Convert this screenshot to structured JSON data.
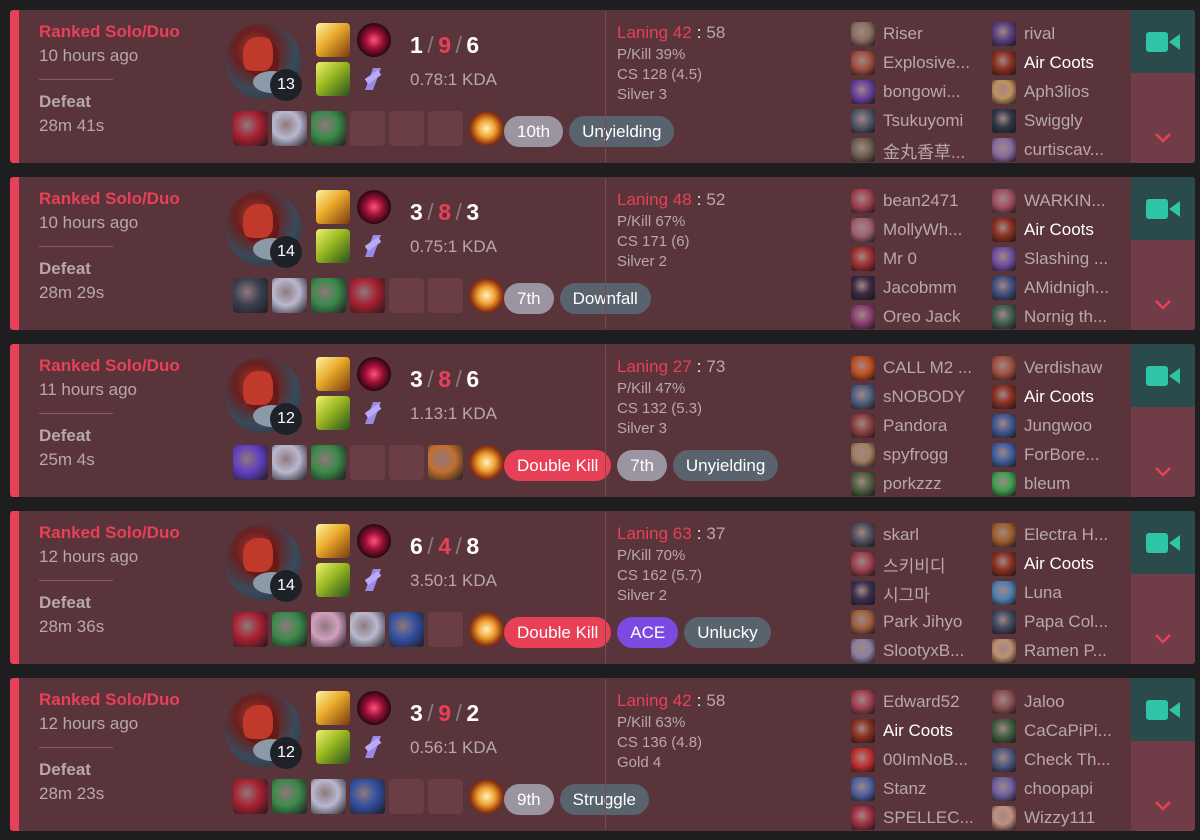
{
  "matches": [
    {
      "queue": "Ranked Solo/Duo",
      "time_ago": "10 hours ago",
      "result": "Defeat",
      "duration": "28m 41s",
      "level": "13",
      "kills": "1",
      "deaths": "9",
      "assists": "6",
      "kda_ratio": "0.78:1 KDA",
      "items": [
        "#a82030",
        "#b8b8d0",
        "#3a8a4a",
        "",
        "",
        ""
      ],
      "badges": [
        {
          "label": "10th",
          "style": "gray"
        },
        {
          "label": "Unyielding",
          "style": "slate"
        }
      ],
      "laning_label": "Laning 42",
      "laning_opp": "58",
      "pkill": "P/Kill 39%",
      "cs": "CS 128 (4.5)",
      "tier": "Silver 3",
      "team_left": [
        {
          "name": "Riser",
          "color": "#8a7060"
        },
        {
          "name": "Explosive...",
          "color": "#a05040"
        },
        {
          "name": "bongowi...",
          "color": "#6a40a0"
        },
        {
          "name": "Tsukuyomi",
          "color": "#505868"
        },
        {
          "name": "金丸香草...",
          "color": "#706050"
        }
      ],
      "team_right": [
        {
          "name": "rival",
          "color": "#5a4080"
        },
        {
          "name": "Air Coots",
          "color": "#8a3020",
          "me": true
        },
        {
          "name": "Aph3lios",
          "color": "#c09060"
        },
        {
          "name": "Swiggly",
          "color": "#303848"
        },
        {
          "name": "curtiscav...",
          "color": "#8a6aa0"
        }
      ]
    },
    {
      "queue": "Ranked Solo/Duo",
      "time_ago": "10 hours ago",
      "result": "Defeat",
      "duration": "28m 29s",
      "level": "14",
      "kills": "3",
      "deaths": "8",
      "assists": "3",
      "kda_ratio": "0.75:1 KDA",
      "items": [
        "#3a4050",
        "#b8b8d0",
        "#3a8a4a",
        "#a82030",
        "",
        ""
      ],
      "badges": [
        {
          "label": "7th",
          "style": "gray"
        },
        {
          "label": "Downfall",
          "style": "slate"
        }
      ],
      "laning_label": "Laning 48",
      "laning_opp": "52",
      "pkill": "P/Kill 67%",
      "cs": "CS 171 (6)",
      "tier": "Silver 2",
      "team_left": [
        {
          "name": "bean2471",
          "color": "#a04050"
        },
        {
          "name": "MollyWh...",
          "color": "#a06070"
        },
        {
          "name": "Mr 0",
          "color": "#a03030"
        },
        {
          "name": "Jacobmm",
          "color": "#3a2a40"
        },
        {
          "name": "Oreo Jack",
          "color": "#8a4070"
        }
      ],
      "team_right": [
        {
          "name": "WARKIN...",
          "color": "#a05060"
        },
        {
          "name": "Air Coots",
          "color": "#8a3020",
          "me": true
        },
        {
          "name": "Slashing ...",
          "color": "#7050a0"
        },
        {
          "name": "AMidnigh...",
          "color": "#405080"
        },
        {
          "name": "Nornig th...",
          "color": "#406050"
        }
      ]
    },
    {
      "queue": "Ranked Solo/Duo",
      "time_ago": "11 hours ago",
      "result": "Defeat",
      "duration": "25m 4s",
      "level": "12",
      "kills": "3",
      "deaths": "8",
      "assists": "6",
      "kda_ratio": "1.13:1 KDA",
      "items": [
        "#6040c0",
        "#b8b8d0",
        "#3a8a4a",
        "",
        "",
        "#c07030"
      ],
      "badges": [
        {
          "label": "Double Kill",
          "style": "red"
        },
        {
          "label": "7th",
          "style": "gray"
        },
        {
          "label": "Unyielding",
          "style": "slate"
        }
      ],
      "laning_label": "Laning 27",
      "laning_opp": "73",
      "pkill": "P/Kill 47%",
      "cs": "CS 132 (5.3)",
      "tier": "Silver 3",
      "team_left": [
        {
          "name": "CALL M2 ...",
          "color": "#c05020"
        },
        {
          "name": "sNOBODY",
          "color": "#506080"
        },
        {
          "name": "Pandora",
          "color": "#8a4040"
        },
        {
          "name": "spyfrogg",
          "color": "#a08060"
        },
        {
          "name": "porkzzz",
          "color": "#506040"
        }
      ],
      "team_right": [
        {
          "name": "Verdishaw",
          "color": "#a05040"
        },
        {
          "name": "Air Coots",
          "color": "#8a3020",
          "me": true
        },
        {
          "name": "Jungwoo",
          "color": "#405890"
        },
        {
          "name": "ForBore...",
          "color": "#4060a0"
        },
        {
          "name": "bleum",
          "color": "#40a050"
        }
      ]
    },
    {
      "queue": "Ranked Solo/Duo",
      "time_ago": "12 hours ago",
      "result": "Defeat",
      "duration": "28m 36s",
      "level": "14",
      "kills": "6",
      "deaths": "4",
      "assists": "8",
      "kda_ratio": "3.50:1 KDA",
      "items": [
        "#a82030",
        "#3a8a4a",
        "#d0a0c0",
        "#b8b8d0",
        "#3050a0",
        ""
      ],
      "badges": [
        {
          "label": "Double Kill",
          "style": "red"
        },
        {
          "label": "ACE",
          "style": "purple"
        },
        {
          "label": "Unlucky",
          "style": "slate"
        }
      ],
      "laning_label": "Laning 63",
      "laning_opp": "37",
      "pkill": "P/Kill 70%",
      "cs": "CS 162 (5.7)",
      "tier": "Silver 2",
      "team_left": [
        {
          "name": "skarl",
          "color": "#505060"
        },
        {
          "name": "스키비디",
          "color": "#a04050"
        },
        {
          "name": "시그마",
          "color": "#3a3050"
        },
        {
          "name": "Park Jihyo",
          "color": "#a06040"
        },
        {
          "name": "SlootyxB...",
          "color": "#8a80a0"
        }
      ],
      "team_right": [
        {
          "name": "Electra H...",
          "color": "#a06030"
        },
        {
          "name": "Air Coots",
          "color": "#8a3020",
          "me": true
        },
        {
          "name": "Luna",
          "color": "#5080b0"
        },
        {
          "name": "Papa Col...",
          "color": "#404860"
        },
        {
          "name": "Ramen P...",
          "color": "#c09070"
        }
      ]
    },
    {
      "queue": "Ranked Solo/Duo",
      "time_ago": "12 hours ago",
      "result": "Defeat",
      "duration": "28m 23s",
      "level": "12",
      "kills": "3",
      "deaths": "9",
      "assists": "2",
      "kda_ratio": "0.56:1 KDA",
      "items": [
        "#a82030",
        "#3a8a4a",
        "#b8b8d0",
        "#3050a0",
        "",
        ""
      ],
      "badges": [
        {
          "label": "9th",
          "style": "gray"
        },
        {
          "label": "Struggle",
          "style": "slate"
        }
      ],
      "laning_label": "Laning 42",
      "laning_opp": "58",
      "pkill": "P/Kill 63%",
      "cs": "CS 136 (4.8)",
      "tier": "Gold 4",
      "team_left": [
        {
          "name": "Edward52",
          "color": "#a04050"
        },
        {
          "name": "Air Coots",
          "color": "#8a3020",
          "me": true
        },
        {
          "name": "00ImNoB...",
          "color": "#c03030"
        },
        {
          "name": "Stanz",
          "color": "#5060a0"
        },
        {
          "name": "SPELLEC...",
          "color": "#a03040"
        }
      ],
      "team_right": [
        {
          "name": "Jaloo",
          "color": "#8a5050"
        },
        {
          "name": "CaCaPiPi...",
          "color": "#406040"
        },
        {
          "name": "Check Th...",
          "color": "#505880"
        },
        {
          "name": "choopapi",
          "color": "#7060a0"
        },
        {
          "name": "Wizzy111",
          "color": "#c09080"
        }
      ]
    }
  ],
  "colors": {
    "accent_red": "#e84057",
    "video_button": "#2b4a4c",
    "video_icon": "#2ec4a6"
  },
  "icons": {
    "video": "video-camera-icon",
    "expand": "chevron-down-icon"
  }
}
